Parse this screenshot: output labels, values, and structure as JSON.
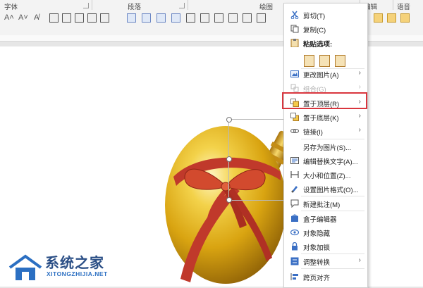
{
  "ribbon": {
    "groups": [
      {
        "label": "字体"
      },
      {
        "label": "段落"
      },
      {
        "label": "绘图"
      },
      {
        "label": "编辑"
      },
      {
        "label": "语音"
      }
    ]
  },
  "context_menu": {
    "items": [
      {
        "label": "剪切(T)",
        "icon": "scissors-icon"
      },
      {
        "label": "复制(C)",
        "icon": "copy-icon"
      },
      {
        "label": "粘贴选项:",
        "icon": "paste-icon"
      },
      {
        "label": "更改图片(A)",
        "icon": "change-picture-icon",
        "submenu": true
      },
      {
        "label": "组合(G)",
        "icon": "group-icon",
        "submenu": true,
        "disabled": true
      },
      {
        "label": "置于顶层(R)",
        "icon": "bring-to-front-icon",
        "submenu": true,
        "highlighted": true
      },
      {
        "label": "置于底层(K)",
        "icon": "send-to-back-icon",
        "submenu": true
      },
      {
        "label": "链接(I)",
        "icon": "link-icon",
        "submenu": true
      },
      {
        "label": "另存为图片(S)...",
        "icon": ""
      },
      {
        "label": "编辑替换文字(A)...",
        "icon": "alt-text-icon"
      },
      {
        "label": "大小和位置(Z)...",
        "icon": "size-position-icon"
      },
      {
        "label": "设置图片格式(O)...",
        "icon": "format-picture-icon"
      },
      {
        "label": "新建批注(M)",
        "icon": "comment-icon"
      },
      {
        "label": "盒子编辑器",
        "icon": "box-editor-icon"
      },
      {
        "label": "对象隐藏",
        "icon": "eye-icon"
      },
      {
        "label": "对象加锁",
        "icon": "lock-icon"
      },
      {
        "label": "调整转换",
        "icon": "convert-icon",
        "submenu": true
      },
      {
        "label": "跨页对齐",
        "icon": "align-icon"
      }
    ],
    "paste_options": [
      "paste-keep-format-icon",
      "paste-picture-icon",
      "paste-text-only-icon"
    ]
  },
  "watermark": {
    "title": "系统之家",
    "subtitle": "XITONGZHIJIA.NET"
  },
  "colors": {
    "highlight_border": "#d9363e",
    "egg_gold": "#e8b820",
    "ribbon_red": "#c0392b"
  }
}
